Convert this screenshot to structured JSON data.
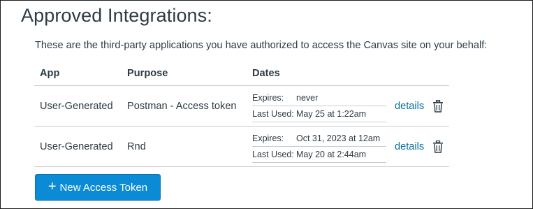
{
  "heading": "Approved Integrations:",
  "intro": "These are the third-party applications you have authorized to access the Canvas site on your behalf:",
  "table": {
    "headers": [
      "App",
      "Purpose",
      "Dates"
    ],
    "rows": [
      {
        "app": "User-Generated",
        "purpose": "Postman - Access token",
        "expires_label": "Expires:",
        "expires_value": "never",
        "last_used_label": "Last Used:",
        "last_used_value": "May 25 at 1:22am",
        "details": "details",
        "delete_icon": "trash-icon"
      },
      {
        "app": "User-Generated",
        "purpose": "Rnd",
        "expires_label": "Expires:",
        "expires_value": "Oct 31, 2023 at 12am",
        "last_used_label": "Last Used:",
        "last_used_value": "May 20 at 2:44am",
        "details": "details",
        "delete_icon": "trash-icon"
      }
    ]
  },
  "new_token_button": {
    "icon": "plus-icon",
    "label": "New Access Token"
  },
  "colors": {
    "link": "#0770a3",
    "button": "#0b8bd6",
    "text": "#2d3b45"
  }
}
